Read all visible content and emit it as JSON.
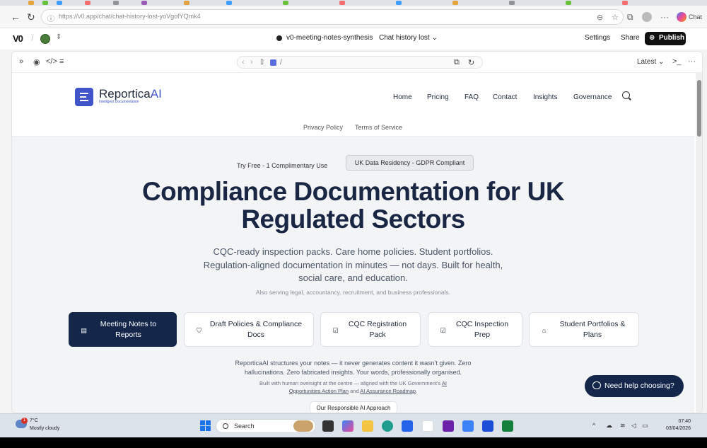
{
  "browser": {
    "url": "https://v0.app/chat/chat-history-lost-yoVgofYQmk4",
    "copilot_label": "Chat"
  },
  "v0": {
    "logo": "V0",
    "chat_title": "v0-meeting-notes-synthesis",
    "chat_history": "Chat history lost",
    "settings_label": "Settings",
    "share_label": "Share",
    "publish_label": "Publish"
  },
  "preview": {
    "path": "/",
    "version_label": "Latest"
  },
  "site": {
    "brand_main": "Reportica",
    "brand_accent": "AI",
    "tagline": "Intelligent Documentation",
    "nav": [
      "Home",
      "Pricing",
      "FAQ",
      "Contact",
      "Insights",
      "Governance"
    ],
    "subnav": [
      "Privacy Policy",
      "Terms of Service"
    ],
    "pill_free": "Try Free - 1 Complimentary Use",
    "pill_residency": "UK Data Residency - GDPR Compliant",
    "hero_line1": "Compliance Documentation for UK",
    "hero_line2": "Regulated Sectors",
    "sub_line1": "CQC-ready inspection packs. Care home policies. Student portfolios.",
    "sub_line2": "Regulation-aligned documentation in minutes — not days. Built for health,",
    "sub_line3": "social care, and education.",
    "note": "Also serving legal, accountancy, recruitment, and business professionals.",
    "ctas": [
      {
        "line1": "Meeting Notes to",
        "line2": "Reports"
      },
      {
        "line1": "Draft Policies & Compliance",
        "line2": "Docs"
      },
      {
        "line1": "CQC Registration",
        "line2": "Pack"
      },
      {
        "line1": "CQC Inspection",
        "line2": "Prep"
      },
      {
        "line1": "Student Portfolios &",
        "line2": "Plans"
      }
    ],
    "foot_line1": "ReporticaAI structures your notes — it never generates content it wasn't given. Zero",
    "foot_line2": "hallucinations. Zero fabricated insights. Your words, professionally organised.",
    "small_line1_pre": "Built with human oversight at the centre — aligned with the UK Government's ",
    "small_link1a": "AI",
    "small_link1b": "Opportunities Action Plan",
    "small_and": " and ",
    "small_link2": "AI Assurance Roadmap",
    "small_end": ".",
    "approach_label": "Our Responsible AI Approach",
    "help_label": "Need help choosing?"
  },
  "taskbar": {
    "badge": "1",
    "temp": "7°C",
    "condition": "Mostly cloudy",
    "search_label": "Search",
    "time": "07:40",
    "date": "03/04/2026"
  },
  "colors": {
    "navy": "#14264a",
    "brand_blue": "#4154c9",
    "title": "#1a2744"
  }
}
